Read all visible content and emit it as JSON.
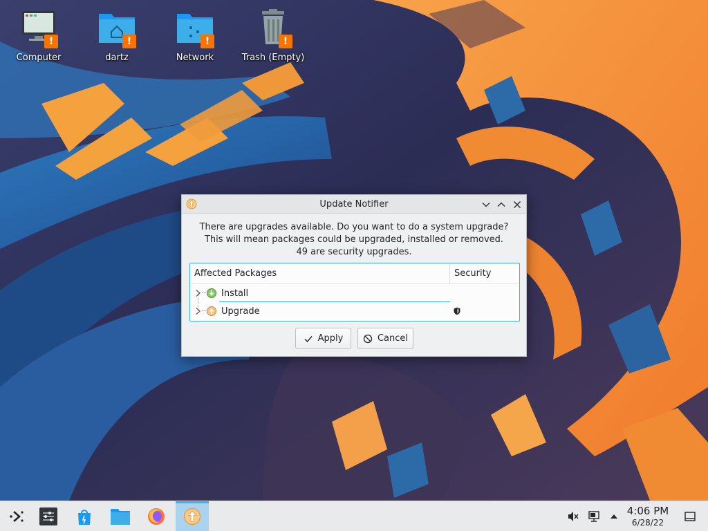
{
  "desktop": {
    "icons": [
      {
        "label": "Computer",
        "icon": "computer-icon"
      },
      {
        "label": "dartz",
        "icon": "home-folder-icon"
      },
      {
        "label": "Network",
        "icon": "network-folder-icon"
      },
      {
        "label": "Trash (Empty)",
        "icon": "trash-icon"
      }
    ],
    "badge_glyph": "!"
  },
  "dialog": {
    "title": "Update Notifier",
    "message_lines": [
      "There are upgrades available. Do you want to do a system upgrade?",
      "This will mean packages could be upgraded, installed or removed.",
      "49 are security upgrades."
    ],
    "columns": [
      "Affected Packages",
      "Security"
    ],
    "rows": [
      {
        "label": "Install",
        "icon": "install-arrow-icon",
        "security": false
      },
      {
        "label": "Upgrade",
        "icon": "upgrade-arrow-icon",
        "security": true
      }
    ],
    "buttons": {
      "apply": "Apply",
      "cancel": "Cancel"
    }
  },
  "taskbar": {
    "items": [
      {
        "name": "application-launcher",
        "icon": "kde-launcher-icon"
      },
      {
        "name": "system-settings",
        "icon": "settings-sliders-icon"
      },
      {
        "name": "discover",
        "icon": "discover-bag-icon"
      },
      {
        "name": "dolphin",
        "icon": "folder-icon"
      },
      {
        "name": "firefox",
        "icon": "firefox-icon"
      },
      {
        "name": "update-notifier",
        "icon": "update-icon",
        "active": true
      }
    ],
    "tray": [
      "volume-muted-icon",
      "network-icon",
      "expand-tray-icon"
    ],
    "clock": {
      "time": "4:06 PM",
      "date": "6/28/22"
    },
    "show_desktop_icon": "show-desktop-icon"
  },
  "colors": {
    "accent": "#3daee9",
    "warning": "#f67400",
    "wallpaper_orange": "#f5923a",
    "wallpaper_blue": "#2d6aa8"
  }
}
